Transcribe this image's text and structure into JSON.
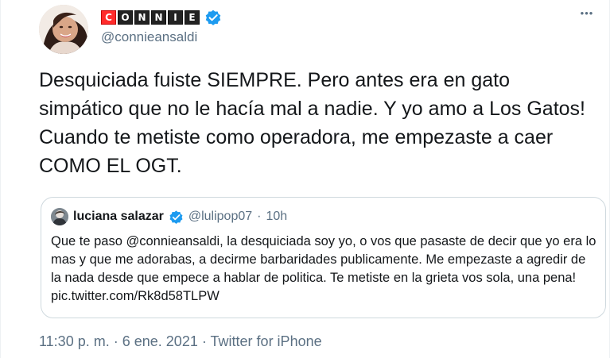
{
  "author": {
    "display_logo_letters": [
      "C",
      "O",
      "N",
      "N",
      "I",
      "E"
    ],
    "handle": "@connieansaldi",
    "verified_icon": "verified-badge-icon",
    "avatar_icon": "profile-photo-avatar"
  },
  "tweet": {
    "text": "Desquiciada fuiste SIEMPRE. Pero antes era en gato simpático que no le hacía mal a nadie. Y yo amo a Los Gatos! Cuando te metiste como operadora, me empezaste a caer COMO EL OGT.",
    "more_icon": "more-options-icon"
  },
  "quoted_tweet": {
    "name": "luciana salazar",
    "handle": "@lulipop07",
    "separator": "·",
    "time": "10h",
    "text": "Que te paso @connieansaldi, la desquiciada soy yo, o vos que pasaste de decir que yo era lo mas y que me adorabas, a decirme barbaridades publicamente. Me empezaste a agredir de la nada desde que empece a hablar de politica. Te metiste en la grieta vos sola, una pena! pic.twitter.com/Rk8d58TLPW"
  },
  "metadata": {
    "time": "11:30 p. m.",
    "date": "6 ene. 2021",
    "source": "Twitter for iPhone",
    "separator": "·"
  },
  "colors": {
    "primary_text": "#14171a",
    "secondary_text": "#5b7083",
    "border": "#cfd9de",
    "verified": "#1d9bf0",
    "logo_red": "#ff2b2b"
  }
}
